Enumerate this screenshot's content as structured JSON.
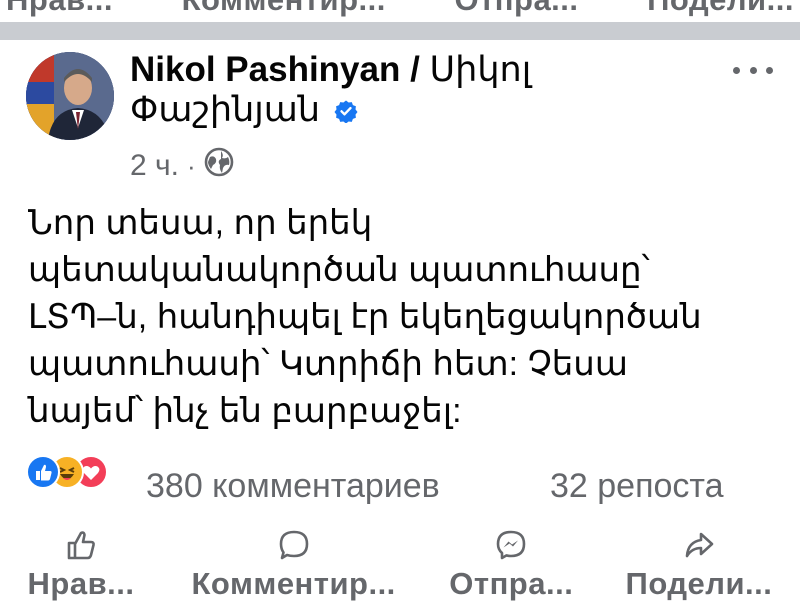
{
  "previous_post": {
    "actions": [
      "Нрав...",
      "Комментир...",
      "Отпра...",
      "Подели..."
    ]
  },
  "post": {
    "author": {
      "name_latin": "Nikol Pashinyan /",
      "name_armenian_line1": "Սիկոլ",
      "name_armenian_line2": "Փաշինյան",
      "verified": true
    },
    "timestamp": "2 ч.",
    "separator_dot": "·",
    "audience_icon": "globe-icon",
    "text_lines": [
      "Նոր տեսա, որ երեկ",
      "պետականակործան պատուհասը՝",
      "ԼՏՊ–ն, հանդիպել էր եկեղեցակործան",
      "պատուհասի՝ Կտրիճի հետ: Չեսա",
      "նայեմ՝ ինչ են բարբաջել:"
    ],
    "reaction_icons": [
      "like-icon",
      "haha-icon",
      "love-icon"
    ],
    "comments_count": "380 комментариев",
    "shares_count": "32 репоста",
    "actions": {
      "like": "Нрав...",
      "comment": "Комментир...",
      "send": "Отпра...",
      "share": "Подели..."
    }
  },
  "colors": {
    "secondary_text": "#65676b",
    "separator": "#c9ccd1",
    "verified_blue": "#1877f2",
    "like_blue": "#1877f2",
    "love_red": "#f33e58",
    "haha_yellow": "#f7b125"
  }
}
